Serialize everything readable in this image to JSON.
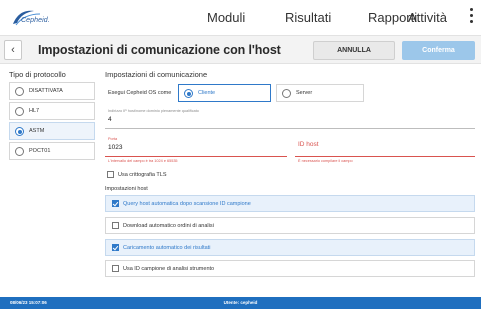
{
  "header": {
    "logo_text": "Cepheid.",
    "nav": [
      "Moduli",
      "Risultati",
      "Rapporti",
      "Attività"
    ]
  },
  "titlebar": {
    "title": "Impostazioni di comunicazione con l'host",
    "cancel_label": "ANNULLA",
    "confirm_label": "Conferma"
  },
  "protocol": {
    "heading": "Tipo di protocollo",
    "options": [
      "DISATTIVATA",
      "HL7",
      "ASTM",
      "POCT01"
    ],
    "selected": "ASTM"
  },
  "comm": {
    "heading": "Impostazioni di comunicazione",
    "exec_label": "Esegui Cepheid OS come",
    "roles": [
      "Cliente",
      "Server"
    ],
    "selected_role": "Cliente",
    "ip_caption": "Indirizzo IP host/nome dominio pienamente qualificato",
    "ip_value": "4",
    "port_caption": "Porta",
    "port_value": "1023",
    "port_help": "L'intervallo del campo è tra 1024 e 65535",
    "hostid_placeholder": "ID host",
    "hostid_help": "È necessario compilare il campo",
    "tls_label": "Usa crittografia TLS",
    "tls_checked": false
  },
  "host": {
    "heading": "Impostazioni host",
    "options": [
      {
        "label": "Query host automatica dopo scansione ID campione",
        "checked": true
      },
      {
        "label": "Download automatico ordini di analisi",
        "checked": false
      },
      {
        "label": "Caricamento automatico dei risultati",
        "checked": true
      },
      {
        "label": "Usa ID campione di analisi strumento",
        "checked": false
      }
    ]
  },
  "status": {
    "datetime": "08/06/23 15:07:06",
    "user": "Utente: cepheid"
  },
  "colors": {
    "accent": "#2f79c9",
    "statusbar": "#1f6fbf",
    "confirm": "#9cc7ea",
    "error": "#d9534f"
  }
}
